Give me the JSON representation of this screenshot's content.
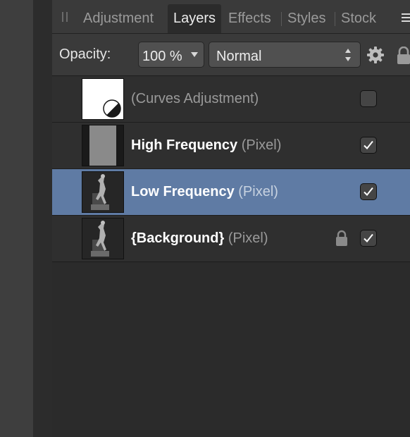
{
  "tabs": [
    {
      "label": "Adjustment",
      "active": false
    },
    {
      "label": "Layers",
      "active": true
    },
    {
      "label": "Effects",
      "active": false
    },
    {
      "label": "Styles",
      "active": false
    },
    {
      "label": "Stock",
      "active": false
    }
  ],
  "options": {
    "opacity_label": "Opacity:",
    "opacity_value": "100 %",
    "blend_mode": "Normal"
  },
  "layers": [
    {
      "name": "(Curves Adjustment)",
      "type": "",
      "visible": false,
      "locked": false,
      "selected": false,
      "thumbnail": "adjustment-icon"
    },
    {
      "name": "High Frequency",
      "type": "(Pixel)",
      "visible": true,
      "locked": false,
      "selected": false,
      "thumbnail": "gray-fill"
    },
    {
      "name": "Low Frequency",
      "type": "(Pixel)",
      "visible": true,
      "locked": false,
      "selected": true,
      "thumbnail": "photo"
    },
    {
      "name": "{Background}",
      "type": "(Pixel)",
      "visible": true,
      "locked": true,
      "selected": false,
      "thumbnail": "photo"
    }
  ],
  "colors": {
    "selection": "#5f7ba4",
    "panel_bg": "#2b2b2b",
    "toolbar_bg": "#3a3a3a"
  }
}
